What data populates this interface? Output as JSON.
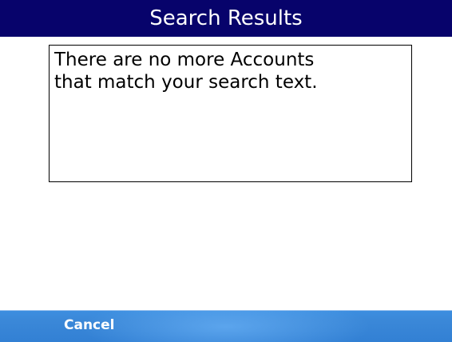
{
  "window": {
    "title": "Search Results"
  },
  "message": {
    "text": "There are no more Accounts\nthat match your search text."
  },
  "softkeys": {
    "left_label": "Cancel"
  },
  "colors": {
    "title_bar": "#07036b",
    "softkey_bar": "#3b88d8",
    "background": "#ffffff"
  }
}
